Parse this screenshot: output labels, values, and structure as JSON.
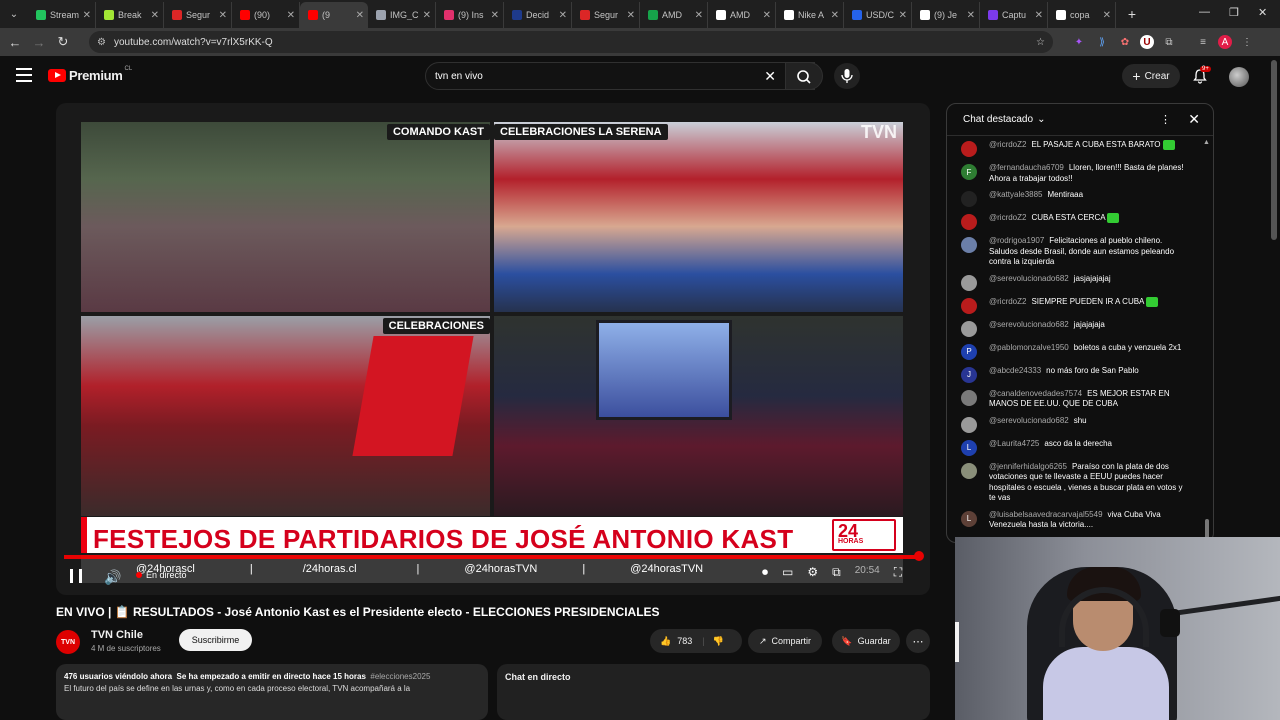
{
  "browser": {
    "tabs": [
      {
        "label": "Stream",
        "color": "#22c55e",
        "active": false
      },
      {
        "label": "Break",
        "color": "#a3e635",
        "active": false
      },
      {
        "label": "Segur",
        "color": "#dc2626",
        "active": false
      },
      {
        "label": "(90)",
        "color": "#ff0000",
        "active": false
      },
      {
        "label": "(9",
        "color": "#ff0000",
        "active": true
      },
      {
        "label": "IMG_C",
        "color": "#9ca3af",
        "active": false
      },
      {
        "label": "(9) Ins",
        "color": "#e1306c",
        "active": false
      },
      {
        "label": "Decid",
        "color": "#1e3a8a",
        "active": false
      },
      {
        "label": "Segur",
        "color": "#dc2626",
        "active": false
      },
      {
        "label": "AMD",
        "color": "#16a34a",
        "active": false
      },
      {
        "label": "AMD",
        "color": "#ffffff",
        "active": false
      },
      {
        "label": "Nike A",
        "color": "#ffffff",
        "active": false
      },
      {
        "label": "USD/C",
        "color": "#2563eb",
        "active": false
      },
      {
        "label": "(9) Je",
        "color": "#ffffff",
        "active": false
      },
      {
        "label": "Captu",
        "color": "#7c3aed",
        "active": false
      },
      {
        "label": "copa",
        "color": "#ffffff",
        "active": false
      }
    ],
    "new_tab": "+",
    "url": "youtube.com/watch?v=v7rlX5rKK-Q",
    "profile_initial": "A"
  },
  "youtube": {
    "logo_text": "Premium",
    "logo_region": "CL",
    "search_value": "tvn en vivo",
    "create_label": "Crear",
    "notif_count": "9+"
  },
  "video": {
    "captions": {
      "top_left": "COMANDO KAST",
      "top_right": "CELEBRACIONES LA SERENA",
      "bottom_left": "CELEBRACIONES"
    },
    "headline": "FESTEJOS DE PARTIDARIOS DE JOSÉ ANTONIO KAST",
    "channel_bug": "TVN",
    "logo_24": "24",
    "logo_24_sub": "HORAS",
    "socials": [
      "@24horascl",
      "/24horas.cl",
      "@24horasTVN",
      "@24horasTVN"
    ],
    "live_label": "En directo",
    "time_overlay": "20:54"
  },
  "page": {
    "title": "EN VIVO | 📋 RESULTADOS - José Antonio Kast es el Presidente electo - ELECCIONES PRESIDENCIALES",
    "channel_name": "TVN Chile",
    "channel_abbr": "TVN",
    "subscribers": "4 M de suscriptores",
    "subscribe_label": "Suscribirme",
    "likes": "783",
    "share_label": "Compartir",
    "save_label": "Guardar",
    "desc_viewers": "476",
    "desc_viewers_suffix": "usuarios viéndolo ahora",
    "desc_started": "Se ha empezado a emitir en directo hace 15 horas",
    "desc_tag": "#elecciones2025",
    "desc_text": "El futuro del país se define en las urnas y, como en cada proceso electoral, TVN acompañará a la",
    "chat_live_label": "Chat en directo"
  },
  "chat": {
    "header": "Chat destacado",
    "messages": [
      {
        "author": "@ricrdoZ2",
        "text": "EL PASAJE A CUBA ESTA BARATO",
        "emoji": true,
        "avatar": "#b91c1c",
        "initial": ""
      },
      {
        "author": "@fernandaucha6709",
        "text": "Lloren, lloren!!! Basta de planes! Ahora a trabajar todos!!",
        "emoji": false,
        "avatar": "#2e7d32",
        "initial": "F"
      },
      {
        "author": "@kattyale3885",
        "text": "Mentiraaa",
        "emoji": false,
        "avatar": "#222222",
        "initial": ""
      },
      {
        "author": "@ricrdoZ2",
        "text": "CUBA ESTA CERCA",
        "emoji": true,
        "avatar": "#b91c1c",
        "initial": ""
      },
      {
        "author": "@rodrigoa1907",
        "text": "Felicitaciones al pueblo chileno. Saludos desde Brasil, donde aun estamos peleando contra la izquierda",
        "emoji": false,
        "avatar": "#6b7fa8",
        "initial": ""
      },
      {
        "author": "@serevolucionado682",
        "text": "jasjajajajaj",
        "emoji": false,
        "avatar": "#9a9a9a",
        "initial": ""
      },
      {
        "author": "@ricrdoZ2",
        "text": "SIEMPRE PUEDEN IR A CUBA",
        "emoji": true,
        "avatar": "#b91c1c",
        "initial": ""
      },
      {
        "author": "@serevolucionado682",
        "text": "jajajajaja",
        "emoji": false,
        "avatar": "#9a9a9a",
        "initial": ""
      },
      {
        "author": "@pablomonzalve1950",
        "text": "boletos a cuba y venzuela 2x1",
        "emoji": false,
        "avatar": "#1e40af",
        "initial": "P"
      },
      {
        "author": "@abcde24333",
        "text": "no más foro de San Pablo",
        "emoji": false,
        "avatar": "#283593",
        "initial": "J"
      },
      {
        "author": "@canaldenovedades7574",
        "text": "ES MEJOR ESTAR EN MANOS DE EE.UU. QUE DE CUBA",
        "emoji": false,
        "avatar": "#7a7a7a",
        "initial": ""
      },
      {
        "author": "@serevolucionado682",
        "text": "shu",
        "emoji": false,
        "avatar": "#9a9a9a",
        "initial": ""
      },
      {
        "author": "@Laurita4725",
        "text": "asco da la derecha",
        "emoji": false,
        "avatar": "#1e40af",
        "initial": "L"
      },
      {
        "author": "@jenniferhidalgo6265",
        "text": "Paraíso con la plata de dos votaciones que te llevaste a EEUU puedes hacer hospitales o escuela , vienes a buscar plata en votos y te vas",
        "emoji": false,
        "avatar": "#8a8f7a",
        "initial": ""
      },
      {
        "author": "@luisabelsaavedracarvajal5549",
        "text": "viva Cuba Viva Venezuela hasta la victoria....",
        "emoji": false,
        "avatar": "#5d4037",
        "initial": "L"
      }
    ]
  }
}
